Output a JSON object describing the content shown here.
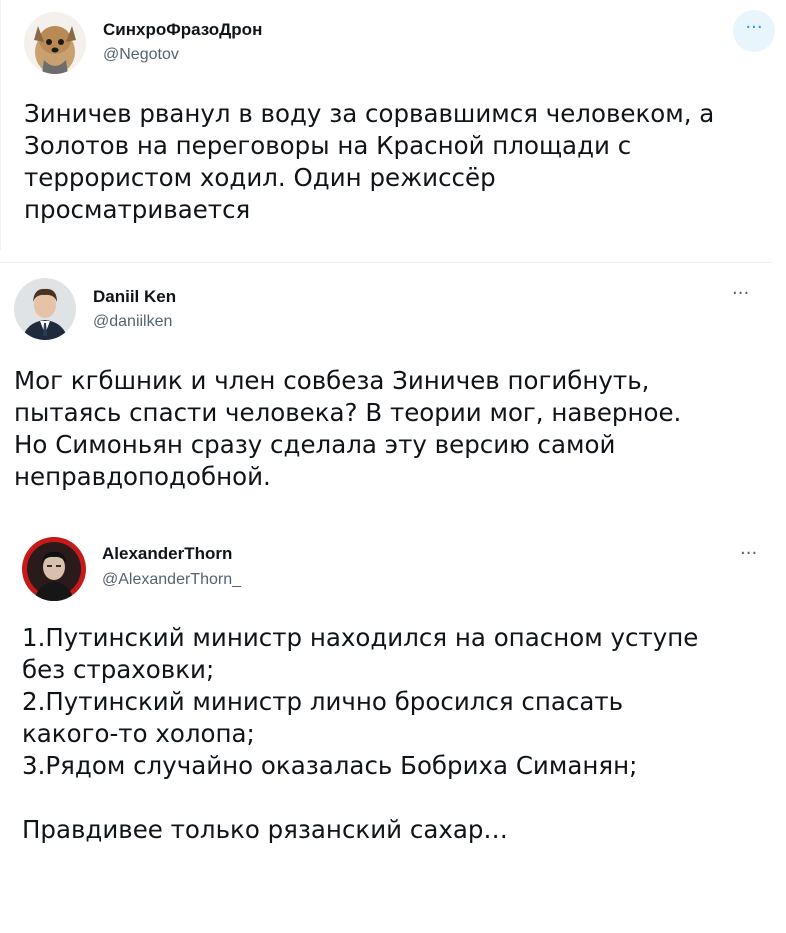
{
  "tweets": [
    {
      "name": "СинхроФразоДрон",
      "handle": "@Negotov",
      "more_icon": "more-horizontal-icon",
      "text": "Зиничев рванул в воду за сорвавшимся человеком, а\nЗолотов на переговоры на Красной площади с\nтеррористом ходил. Один режиссёр\nпросматривается"
    },
    {
      "name": "Daniil Ken",
      "handle": "@daniilken",
      "more_icon": "more-horizontal-icon",
      "text": "Мог кгбшник и член совбеза Зиничев погибнуть,\nпытаясь спасти человека? В теории мог, наверное.\nНо Симоньян сразу сделала эту версию самой\nнеправдоподобной."
    },
    {
      "name": "AlexanderThorn",
      "handle": "@AlexanderThorn_",
      "more_icon": "more-horizontal-icon",
      "text": "1.Путинский министр находился на опасном уступе\nбез страховки;\n2.Путинский министр лично бросился спасать\nкакого-то холопа;\n3.Рядом случайно оказалась Бобриха Симанян;\n\nПравдивее только рязанский сахар…"
    }
  ],
  "more_glyph": "···",
  "colors": {
    "accent": "#1d9bf0",
    "secondary_text": "#536471",
    "divider": "#eff3f4"
  }
}
